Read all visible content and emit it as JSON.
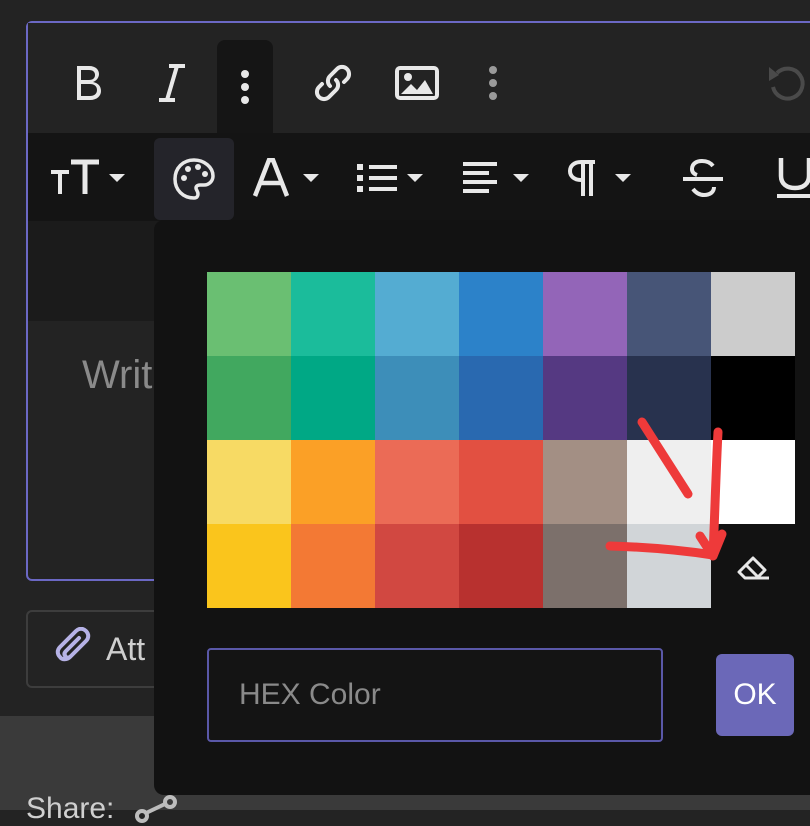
{
  "editor": {
    "placeholder": "Writ",
    "border_color": "#6b68c4"
  },
  "toolbar": {
    "row1": [
      "bold-icon",
      "italic-icon",
      "more-vertical-icon",
      "link-icon",
      "image-icon",
      "more-vertical-icon",
      "undo-icon"
    ],
    "row2": [
      "text-size-icon",
      "palette-icon",
      "font-color-icon",
      "list-icon",
      "align-left-icon",
      "paragraph-icon",
      "strikethrough-icon",
      "underline-icon"
    ]
  },
  "attach": {
    "label": "Att"
  },
  "share": {
    "label": "Share:"
  },
  "color_popup": {
    "swatches": [
      [
        "#6abf72",
        "#1bbc9b",
        "#54acd2",
        "#2c82c9",
        "#9365b8",
        "#475577",
        "#cccccc"
      ],
      [
        "#41a85f",
        "#00a885",
        "#3d8eb9",
        "#2969b0",
        "#553982",
        "#28324e",
        "#000000"
      ],
      [
        "#f7da64",
        "#fba026",
        "#eb6b56",
        "#e25041",
        "#a38f84",
        "#efefef",
        "#ffffff"
      ],
      [
        "#fac51c",
        "#f37934",
        "#d14841",
        "#b8312f",
        "#7c706b",
        "#d1d5d8",
        null
      ]
    ],
    "hex_placeholder": "HEX Color",
    "ok_label": "OK",
    "ok_color": "#6b68b8",
    "annotation_color": "#ee3a3a"
  }
}
